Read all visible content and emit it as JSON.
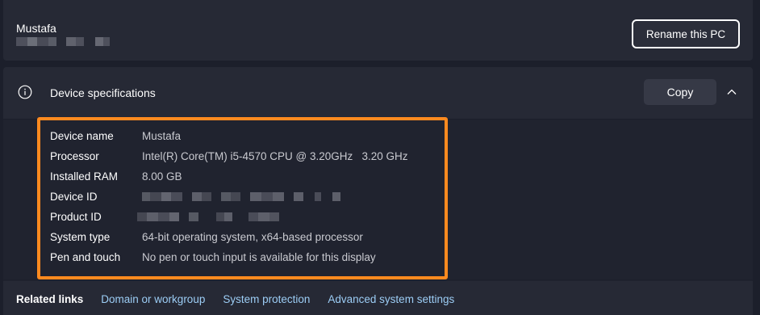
{
  "pc": {
    "name": "Mustafa",
    "rename_label": "Rename this PC"
  },
  "specs": {
    "title": "Device specifications",
    "copy_label": "Copy",
    "rows": [
      {
        "label": "Device name",
        "value": "Mustafa"
      },
      {
        "label": "Processor",
        "value": "Intel(R) Core(TM) i5-4570 CPU @ 3.20GHz   3.20 GHz"
      },
      {
        "label": "Installed RAM",
        "value": "8.00 GB"
      },
      {
        "label": "Device ID",
        "value": ""
      },
      {
        "label": "Product ID",
        "value": ""
      },
      {
        "label": "System type",
        "value": "64-bit operating system, x64-based processor"
      },
      {
        "label": "Pen and touch",
        "value": "No pen or touch input is available for this display"
      }
    ]
  },
  "related": {
    "label": "Related links",
    "links": [
      "Domain or workgroup",
      "System protection",
      "Advanced system settings"
    ]
  },
  "colors": {
    "highlight": "#ff8a1f",
    "link": "#9ccdf5",
    "background": "#1c1f2b",
    "card": "#262935"
  },
  "icons": [
    "info-icon",
    "chevron-up-icon"
  ]
}
